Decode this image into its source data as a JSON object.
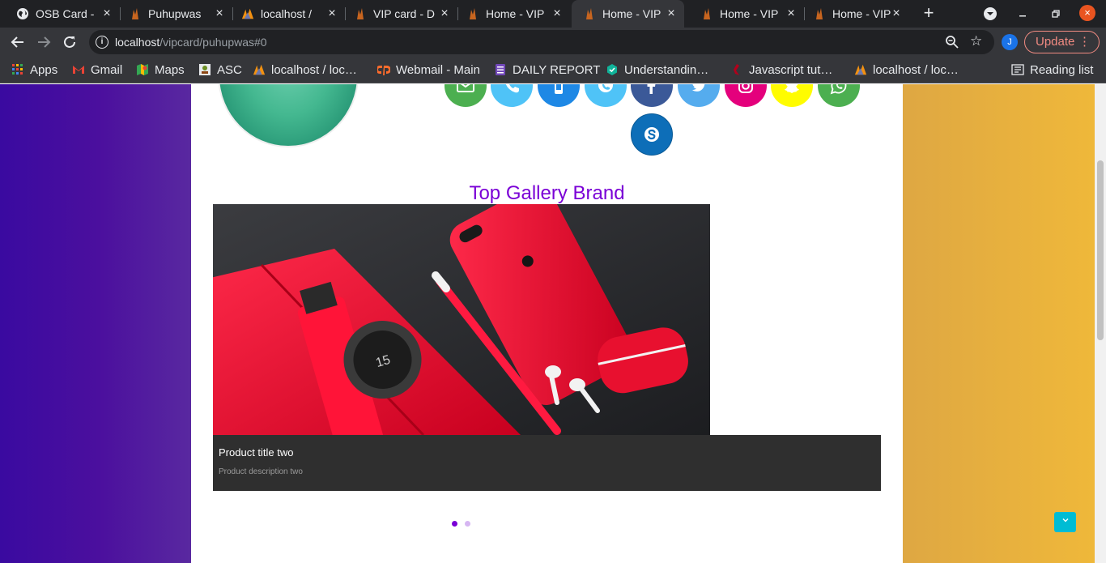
{
  "tabs": [
    {
      "title": "OSB Card -",
      "icon": "globe-icon"
    },
    {
      "title": "Puhupwas",
      "icon": "flame-icon"
    },
    {
      "title": "localhost /",
      "icon": "phpmyadmin-icon"
    },
    {
      "title": "VIP card - D",
      "icon": "flame-icon"
    },
    {
      "title": "Home - VIP",
      "icon": "flame-icon"
    },
    {
      "title": "Home - VIP",
      "icon": "flame-icon",
      "active": true
    },
    {
      "title": "Home - VIP",
      "icon": "flame-icon"
    },
    {
      "title": "Home - VIP",
      "icon": "flame-icon"
    }
  ],
  "tab_close_glyph": "×",
  "new_tab_glyph": "+",
  "address": {
    "host": "localhost",
    "path": "/vipcard/puhupwas#0"
  },
  "avatar_letter": "J",
  "update_label": "Update",
  "bookmarks": [
    {
      "label": "Apps",
      "icon": "apps-grid-icon"
    },
    {
      "label": "Gmail",
      "icon": "gmail-icon"
    },
    {
      "label": "Maps",
      "icon": "maps-icon"
    },
    {
      "label": "ASC",
      "icon": "asc-icon"
    },
    {
      "label": "localhost / loc…",
      "icon": "phpmyadmin-icon"
    },
    {
      "label": "Webmail - Main",
      "icon": "cpanel-icon"
    },
    {
      "label": "DAILY REPORT",
      "icon": "forms-icon"
    },
    {
      "label": "Understandin…",
      "icon": "hexagon-icon"
    },
    {
      "label": "Javascript tut…",
      "icon": "js-icon"
    },
    {
      "label": "localhost / loc…",
      "icon": "phpmyadmin-icon"
    }
  ],
  "reading_list_label": "Reading list",
  "social_icons": [
    {
      "name": "email-icon",
      "color": "#4caf50"
    },
    {
      "name": "phone-icon",
      "color": "#4fc3f7"
    },
    {
      "name": "mobile-icon",
      "color": "#1e88e5"
    },
    {
      "name": "viber-icon",
      "color": "#4fc3f7"
    },
    {
      "name": "facebook-icon",
      "color": "#3b5998"
    },
    {
      "name": "twitter-icon",
      "color": "#55acee"
    },
    {
      "name": "instagram-icon",
      "color": "#e4007c"
    },
    {
      "name": "snapchat-icon",
      "color": "#fffc00"
    },
    {
      "name": "whatsapp-icon",
      "color": "#4caf50"
    },
    {
      "name": "skype-icon",
      "color": "#0d6eb8"
    }
  ],
  "gallery": {
    "title": "Top Gallery Brand",
    "slide": {
      "title": "Product title two",
      "description": "Product description two",
      "image": "red-iphone-watch-airpods-photo"
    },
    "slide_count": 2,
    "active_slide": 1
  },
  "colors": {
    "accent_purple": "#7a00d6",
    "scroll_top_button": "#00bcd4"
  }
}
